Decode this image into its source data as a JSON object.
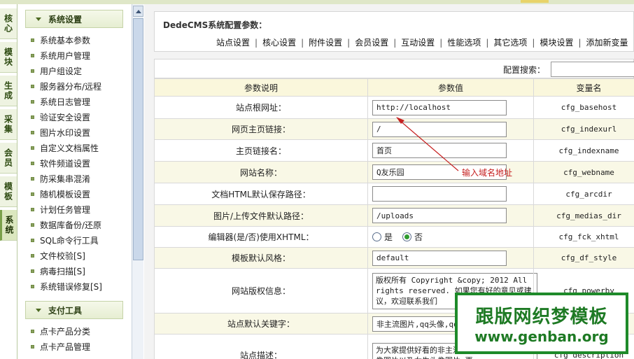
{
  "vtabs": [
    "核心",
    "模块",
    "生成",
    "采集",
    "会员",
    "模板",
    "系统"
  ],
  "menu": {
    "section1": "系统设置",
    "items1": [
      "系统基本参数",
      "系统用户管理",
      "用户组设定",
      "服务器分布/远程",
      "系统日志管理",
      "验证安全设置",
      "图片水印设置",
      "自定义文档属性",
      "软件频道设置",
      "防采集串混淆",
      "随机模板设置",
      "计划任务管理",
      "数据库备份/还原",
      "SQL命令行工具",
      "文件校验[S]",
      "病毒扫描[S]",
      "系统错误修复[S]"
    ],
    "section2": "支付工具",
    "items2": [
      "点卡产品分类",
      "点卡产品管理"
    ]
  },
  "main": {
    "title": "DedeCMS系统配置参数：",
    "tabs": [
      "站点设置",
      "核心设置",
      "附件设置",
      "会员设置",
      "互动设置",
      "性能选项",
      "其它选项",
      "模块设置",
      "添加新变量"
    ],
    "search_label": "配置搜索：",
    "headers": [
      "参数说明",
      "参数值",
      "变量名"
    ],
    "rows": [
      {
        "desc": "站点根网址：",
        "value": "http://localhost",
        "var": "cfg_basehost"
      },
      {
        "desc": "网页主页链接：",
        "value": "/",
        "var": "cfg_indexurl"
      },
      {
        "desc": "主页链接名：",
        "value": "首页",
        "var": "cfg_indexname"
      },
      {
        "desc": "网站名称：",
        "value": "Q友乐园",
        "var": "cfg_webname"
      },
      {
        "desc": "文档HTML默认保存路径：",
        "value": "",
        "var": "cfg_arcdir"
      },
      {
        "desc": "图片/上传文件默认路径：",
        "value": "/uploads",
        "var": "cfg_medias_dir"
      },
      {
        "desc": "编辑器(是/否)使用XHTML：",
        "yes": "是",
        "no": "否",
        "var": "cfg_fck_xhtml"
      },
      {
        "desc": "模板默认风格：",
        "value": "default",
        "var": "cfg_df_style"
      },
      {
        "desc": "网站版权信息：",
        "value": "版权所有 Copyright &copy; 2012 All rights reserved. 如果您有好的意见或建议，欢迎联系我们",
        "var": "cfg_powerby"
      },
      {
        "desc": "站点默认关键字：",
        "value": "非主流图片,qq头像,qq",
        "var": "cfg_keywords"
      },
      {
        "desc": "站点描述：",
        "value": "为大家提供好看的非主流图片,QQ头像,男生头像图片以及女生头像图片,更",
        "var": "cfg_description"
      }
    ]
  },
  "annotation": "输入域名地址",
  "watermark": {
    "line1": "跟版网织梦模板",
    "line2": "www.genban.org"
  }
}
